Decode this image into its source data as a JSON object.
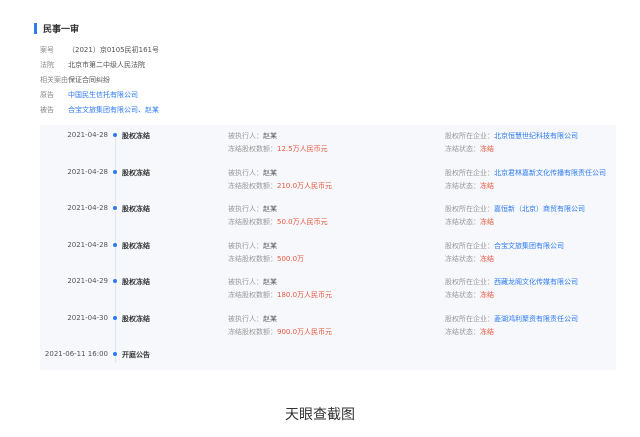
{
  "case": {
    "title": "民事一审",
    "fields": [
      {
        "label": "案号",
        "value": "（2021）京0105民初161号",
        "link": false
      },
      {
        "label": "法院",
        "value": "北京市第二中级人民法院",
        "link": false
      },
      {
        "label": "相关案由",
        "value": "保证合同纠纷",
        "link": false
      },
      {
        "label": "原告",
        "value": "中国民生信托有限公司",
        "link": true
      },
      {
        "label": "被告",
        "value": "合宝文旅集团有限公司、赵某",
        "link": true
      }
    ]
  },
  "timeline": {
    "labels": {
      "executed_person": "被执行人：",
      "frozen_amount": "冻结股权数额：",
      "enterprise": "股权所在企业：",
      "status": "冻结状态："
    },
    "items": [
      {
        "date": "2021-04-28",
        "type": "股权冻结",
        "person": "赵某",
        "amount": "12.5万人民币元",
        "enterprise": "北京恒慧世纪科技有限公司",
        "status": "冻结"
      },
      {
        "date": "2021-04-28",
        "type": "股权冻结",
        "person": "赵某",
        "amount": "210.0万人民币元",
        "enterprise": "北京君林嘉新文化传播有限责任公司",
        "status": "冻结"
      },
      {
        "date": "2021-04-28",
        "type": "股权冻结",
        "person": "赵某",
        "amount": "50.0万人民币元",
        "enterprise": "嘉恒新（北京）商贸有限公司",
        "status": "冻结"
      },
      {
        "date": "2021-04-28",
        "type": "股权冻结",
        "person": "赵某",
        "amount": "500.0万",
        "enterprise": "合宝文旅集团有限公司",
        "status": "冻结"
      },
      {
        "date": "2021-04-29",
        "type": "股权冻结",
        "person": "赵某",
        "amount": "180.0万人民币元",
        "enterprise": "西藏龙阁文化传媒有限公司",
        "status": "冻结"
      },
      {
        "date": "2021-04-30",
        "type": "股权冻结",
        "person": "赵某",
        "amount": "900.0万人民币元",
        "enterprise": "菱湖鸿利聚资有限责任公司",
        "status": "冻结"
      }
    ],
    "last": {
      "date": "2021-06-11 16:00",
      "type": "开庭公告"
    }
  },
  "caption": "天眼查截图"
}
